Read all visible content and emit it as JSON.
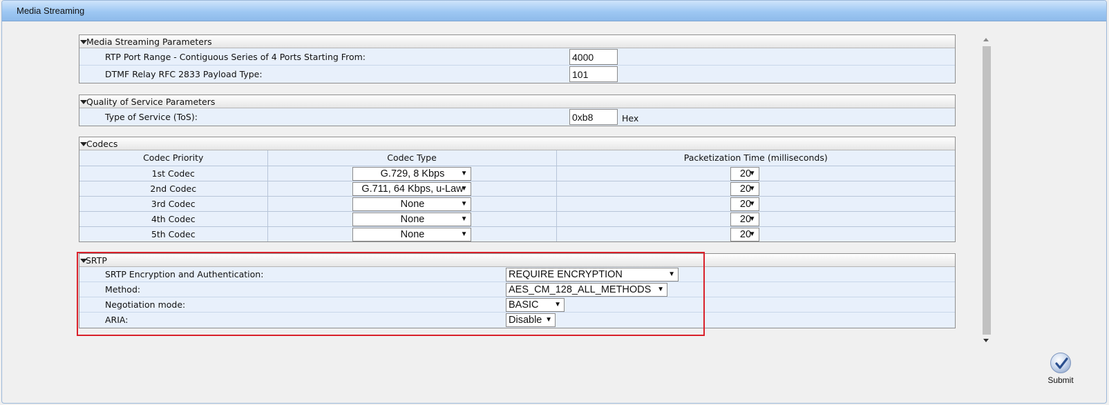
{
  "window": {
    "title": "Media Streaming"
  },
  "media_streaming_parameters": {
    "title": "Media Streaming Parameters",
    "rtp_port_label": "RTP Port Range - Contiguous Series of 4 Ports Starting From:",
    "rtp_port_value": "4000",
    "dtmf_label": "DTMF Relay RFC 2833 Payload Type:",
    "dtmf_value": "101"
  },
  "qos": {
    "title": "Quality of Service Parameters",
    "tos_label": "Type of Service (ToS):",
    "tos_value": "0xb8",
    "tos_unit": "Hex"
  },
  "codecs": {
    "title": "Codecs",
    "headers": [
      "Codec Priority",
      "Codec Type",
      "Packetization Time (milliseconds)"
    ],
    "rows": [
      {
        "priority": "1st Codec",
        "type": "G.729, 8 Kbps",
        "ptime": "20"
      },
      {
        "priority": "2nd Codec",
        "type": "G.711, 64 Kbps, u-Law",
        "ptime": "20"
      },
      {
        "priority": "3rd Codec",
        "type": "None",
        "ptime": "20"
      },
      {
        "priority": "4th Codec",
        "type": "None",
        "ptime": "20"
      },
      {
        "priority": "5th Codec",
        "type": "None",
        "ptime": "20"
      }
    ]
  },
  "srtp": {
    "title": "SRTP",
    "encryption_label": "SRTP Encryption and Authentication:",
    "encryption_value": "REQUIRE ENCRYPTION",
    "method_label": "Method:",
    "method_value": "AES_CM_128_ALL_METHODS",
    "negotiation_label": "Negotiation mode:",
    "negotiation_value": "BASIC",
    "aria_label": "ARIA:",
    "aria_value": "Disable"
  },
  "submit": {
    "label": "Submit"
  },
  "icons": {
    "collapse": "collapse-triangle-icon",
    "dropdown": "dropdown-arrow-icon",
    "submit": "checkmark-icon"
  },
  "colors": {
    "titlebar": "#9ec8f3",
    "row_background": "#e8f0fb",
    "highlight_border": "#d9202a"
  }
}
